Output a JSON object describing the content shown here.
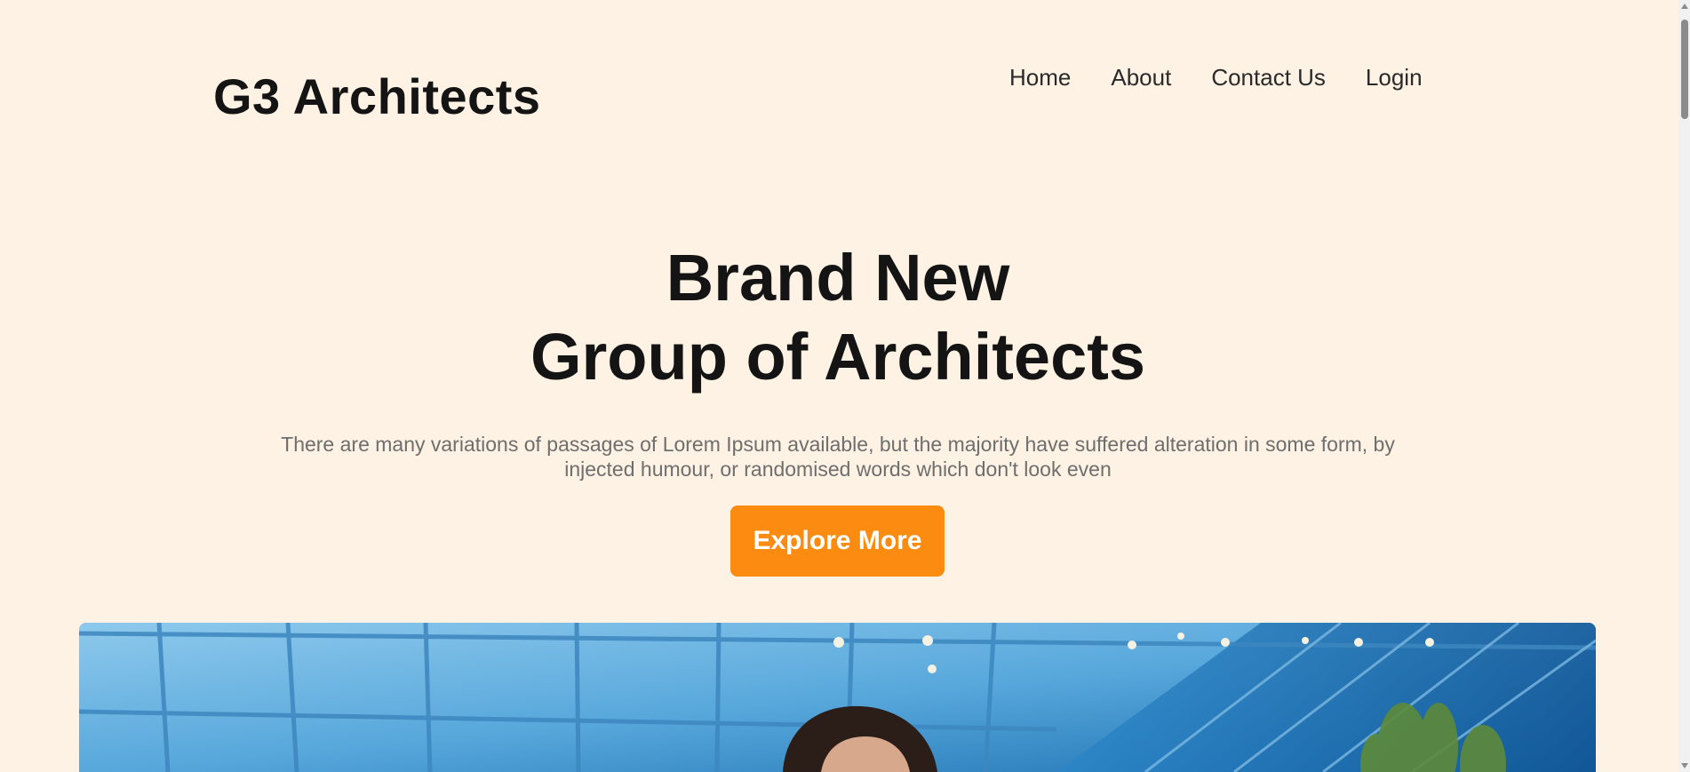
{
  "brand": {
    "name": "G3 Architects"
  },
  "nav": {
    "items": [
      {
        "label": "Home"
      },
      {
        "label": "About"
      },
      {
        "label": "Contact Us"
      },
      {
        "label": "Login"
      }
    ]
  },
  "hero": {
    "title_line1": "Brand New",
    "title_line2": "Group of Architects",
    "description": "There are many variations of passages of Lorem Ipsum available, but the majority have suffered alteration in some form, by injected humour, or randomised words which don't look even",
    "cta_label": "Explore More",
    "image_alt": "Person in front of a glass office building"
  },
  "colors": {
    "background": "#fef2e4",
    "accent": "#fc8b12",
    "heading": "#141414",
    "body_text": "#6e6e6e",
    "sky": "#5aa6d8"
  }
}
